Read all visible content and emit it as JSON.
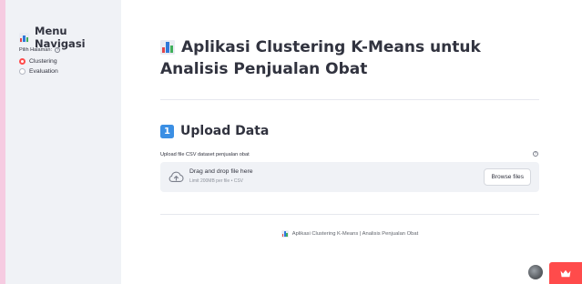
{
  "sidebar": {
    "title": "Menu Navigasi",
    "radio_label": "Pilih Halaman:",
    "options": [
      {
        "label": "Clustering",
        "selected": true
      },
      {
        "label": "Evaluation",
        "selected": false
      }
    ]
  },
  "main": {
    "title": "Aplikasi Clustering K-Means untuk Analisis Penjualan Obat",
    "section": {
      "number": "1",
      "title": "Upload Data"
    },
    "uploader": {
      "label": "Upload file CSV dataset penjualan obat",
      "drop_text": "Drag and drop file here",
      "limit_text": "Limit 200MB per file • CSV",
      "button_label": "Browse files"
    },
    "footer": "Aplikasi Clustering K-Means | Analisis Penjualan Obat"
  },
  "icons": {
    "chart": "bar-chart-icon",
    "help": "question-circle-icon",
    "upload": "cloud-upload-icon",
    "avatar": "user-avatar",
    "crown": "crown-icon"
  },
  "colors": {
    "accent": "#ff4b4b",
    "sidebar_bg": "#f0f2f6",
    "badge_blue": "#3b8fe4"
  }
}
